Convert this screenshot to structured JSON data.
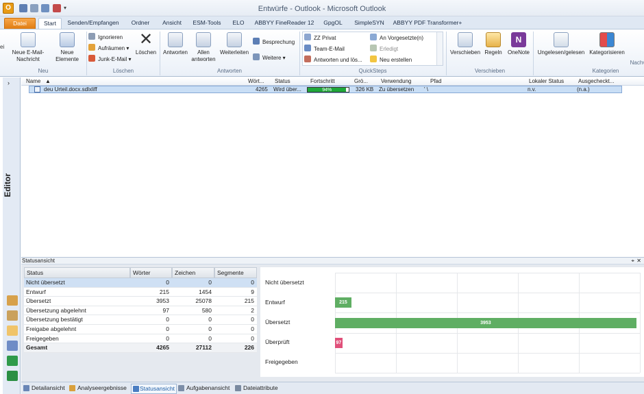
{
  "window": {
    "title": "Entwürfe - Outlook - Microsoft Outlook"
  },
  "tabs": [
    "Datei",
    "Start",
    "Senden/Empfangen",
    "Ordner",
    "Ansicht",
    "ESM-Tools",
    "ELO",
    "ABBYY FineReader 12",
    "GpgOL",
    "SimpleSYN",
    "ABBYY PDF Transformer+"
  ],
  "ribbon": {
    "neu": {
      "new_mail": "Neue E-Mail-Nachricht",
      "new_items": "Neue Elemente",
      "label": "Neu"
    },
    "loeschen": {
      "ignore": "Ignorieren",
      "cleanup": "Aufräumen",
      "junk": "Junk-E-Mail",
      "delete": "Löschen",
      "label": "Löschen"
    },
    "antworten": {
      "reply": "Antworten",
      "reply_all": "Allen antworten",
      "forward": "Weiterleiten",
      "meeting": "Besprechung",
      "more": "Weitere",
      "label": "Antworten"
    },
    "quicksteps": {
      "items": [
        "ZZ Privat",
        "Team-E-Mail",
        "Antworten und lös...",
        "An Vorgesetzte(n)",
        "Erledigt",
        "Neu erstellen"
      ],
      "label": "QuickSteps"
    },
    "verschieben": {
      "move": "Verschieben",
      "rules": "Regeln",
      "onenote": "OneNote",
      "label": "Verschieben"
    },
    "kategorien": {
      "unread": "Ungelesen/gelesen",
      "categorize": "Kategorisieren",
      "label": "Kategorien",
      "next": "Nachv"
    },
    "partial": "ei"
  },
  "editor_label": "Editor",
  "columns": [
    "Name",
    "Wört...",
    "Status",
    "Fortschritt",
    "Grö...",
    "Verwendung",
    "Pfad",
    "Lokaler Status",
    "Ausgecheckt..."
  ],
  "file_row": {
    "name": "deu Urteil.docx.sdlxliff",
    "words": "4265",
    "status": "Wird über...",
    "progress": 94,
    "progress_label": "94%",
    "size": "326 KB",
    "usage": "Zu übersetzen",
    "path": "' \\",
    "local_status": "n.v.",
    "checked_out": "(n.a.)"
  },
  "status_panel_title": "Statusansicht",
  "status_table": {
    "headers": [
      "Status",
      "Wörter",
      "Zeichen",
      "Segmente"
    ],
    "rows": [
      [
        "Nicht übersetzt",
        "0",
        "0",
        "0"
      ],
      [
        "Entwurf",
        "215",
        "1454",
        "9"
      ],
      [
        "Übersetzt",
        "3953",
        "25078",
        "215"
      ],
      [
        "Übersetzung abgelehnt",
        "97",
        "580",
        "2"
      ],
      [
        "Übersetzung bestätigt",
        "0",
        "0",
        "0"
      ],
      [
        "Freigabe abgelehnt",
        "0",
        "0",
        "0"
      ],
      [
        "Freigegeben",
        "0",
        "0",
        "0"
      ],
      [
        "Gesamt",
        "4265",
        "27112",
        "226"
      ]
    ]
  },
  "chart_data": {
    "type": "bar",
    "orientation": "horizontal",
    "categories": [
      "Nicht übersetzt",
      "Entwurf",
      "Übersetzt",
      "Überprüft",
      "Freigegeben"
    ],
    "values": [
      0,
      215,
      3953,
      97,
      0
    ],
    "colors": [
      "#5fae63",
      "#5fae63",
      "#5fae63",
      "#e0507a",
      "#5fae63"
    ],
    "xlim": [
      0,
      4000
    ],
    "grid": true
  },
  "bottom_tabs": [
    "Detailansicht",
    "Analyseergebnisse",
    "Statusansicht",
    "Aufgabenansicht",
    "Dateiattribute"
  ]
}
